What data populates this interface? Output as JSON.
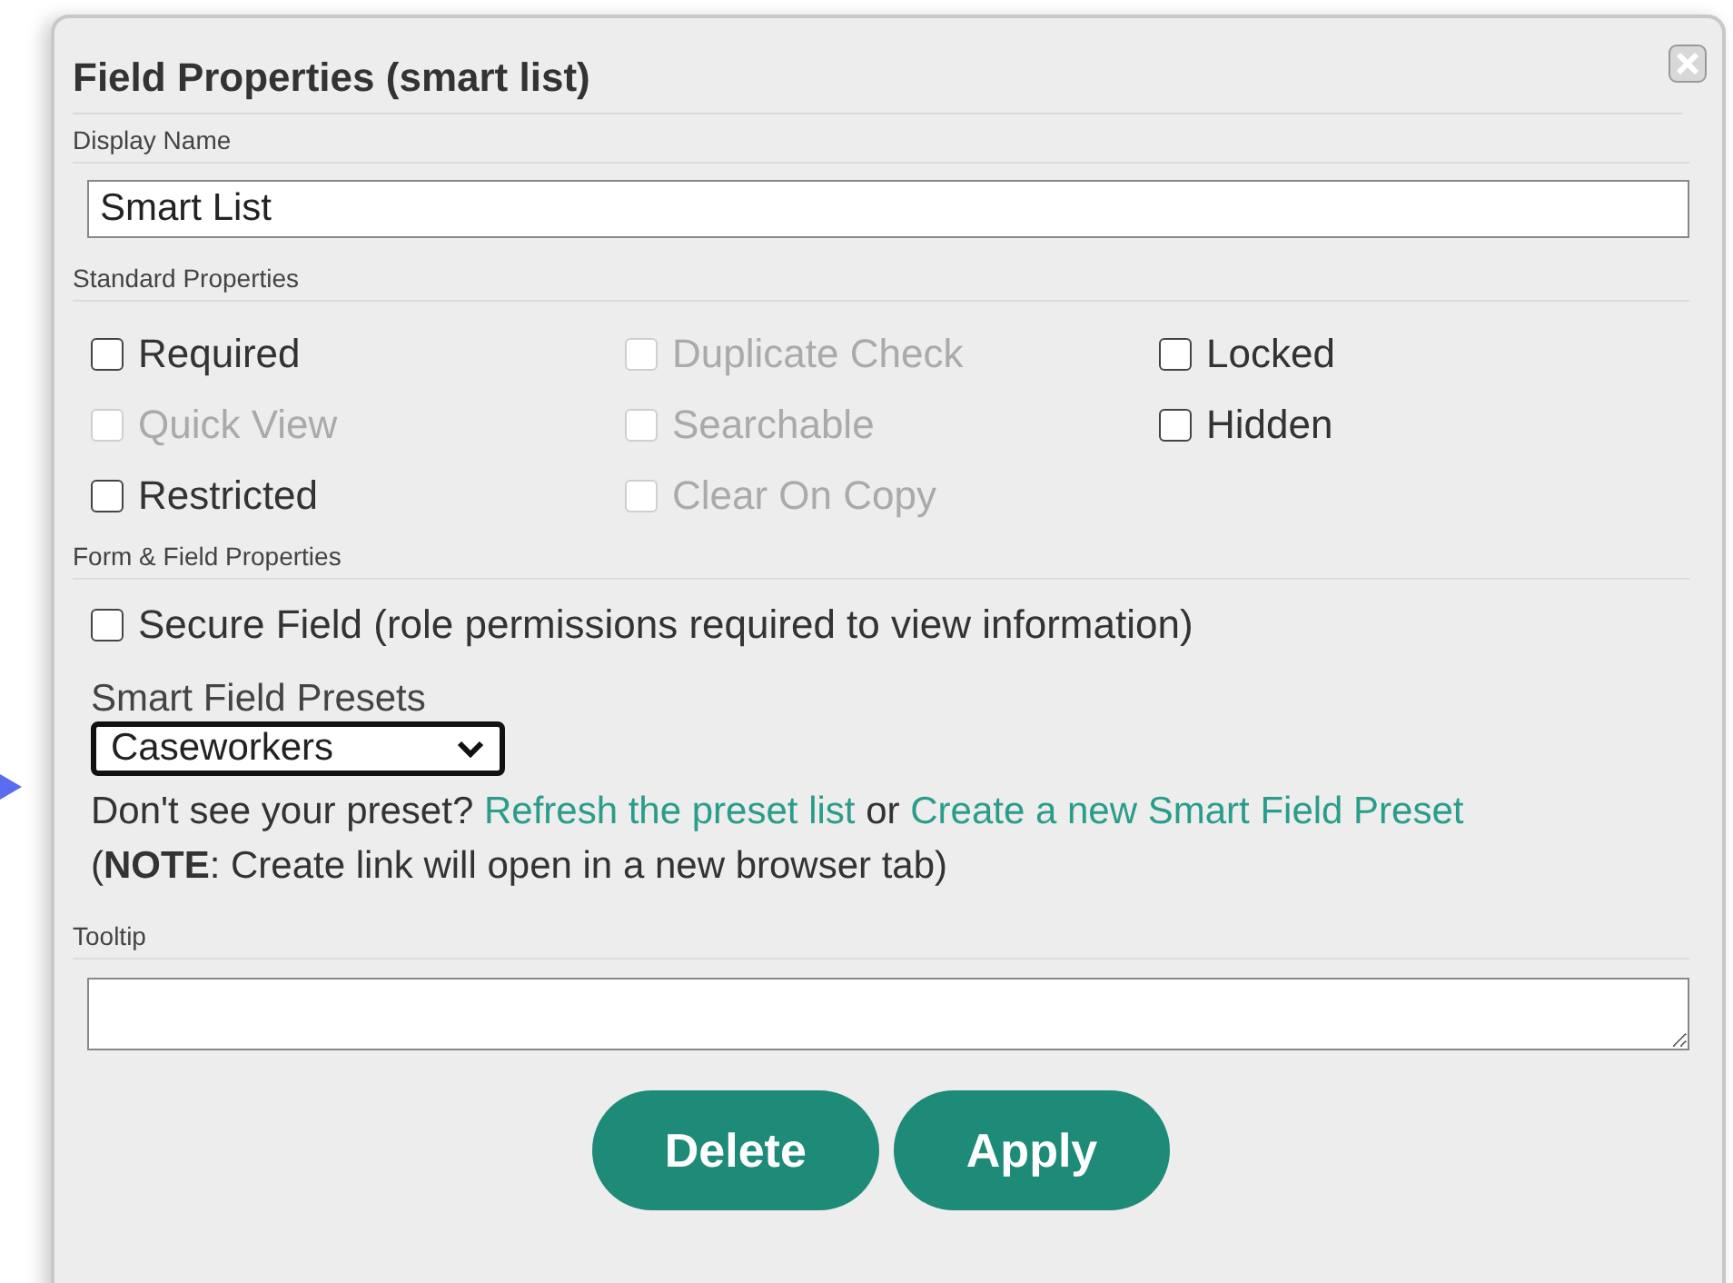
{
  "dialog": {
    "title": "Field Properties (smart list)",
    "display_name": {
      "label": "Display Name",
      "value": "Smart List"
    },
    "standard_properties": {
      "label": "Standard Properties",
      "checkboxes": [
        {
          "label": "Required",
          "checked": false,
          "disabled": false
        },
        {
          "label": "Duplicate Check",
          "checked": false,
          "disabled": true
        },
        {
          "label": "Locked",
          "checked": false,
          "disabled": false
        },
        {
          "label": "Quick View",
          "checked": false,
          "disabled": true
        },
        {
          "label": "Searchable",
          "checked": false,
          "disabled": true
        },
        {
          "label": "Hidden",
          "checked": false,
          "disabled": false
        },
        {
          "label": "Restricted",
          "checked": false,
          "disabled": false
        },
        {
          "label": "Clear On Copy",
          "checked": false,
          "disabled": true
        }
      ]
    },
    "form_field_properties": {
      "label": "Form & Field Properties",
      "secure_field": {
        "label": "Secure Field (role permissions required to view information)",
        "checked": false
      },
      "presets_label": "Smart Field Presets",
      "preset_value": "Caseworkers",
      "help": [
        {
          "kind": "text",
          "text": "Don't see your preset?"
        },
        {
          "kind": "link",
          "text": "Refresh the preset list"
        },
        {
          "kind": "text",
          "text": "or"
        },
        {
          "kind": "link",
          "text": "Create a new Smart Field Preset"
        }
      ],
      "note": "(**NOTE**: Create link will open in a new browser tab)"
    },
    "tooltip": {
      "label": "Tooltip"
    },
    "buttons": [
      "Delete",
      "Apply"
    ]
  }
}
